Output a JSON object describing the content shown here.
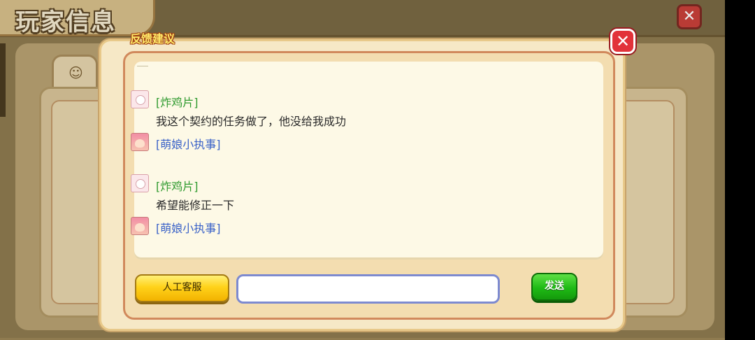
{
  "background": {
    "title": "玩家信息",
    "tab_icon": "face-icon",
    "close_icon": "close-icon"
  },
  "popup": {
    "title": "反馈建议",
    "close_icon": "close-icon"
  },
  "chat": {
    "messages": [
      {
        "sender": "[炸鸡片]",
        "role": "user",
        "text": "我这个契约的任务做了，他没给我成功"
      },
      {
        "sender": "[萌娘小执事]",
        "role": "bot",
        "text": ""
      },
      {
        "sender": "[炸鸡片]",
        "role": "user",
        "text": "希望能修正一下"
      },
      {
        "sender": "[萌娘小执事]",
        "role": "bot",
        "text": ""
      }
    ]
  },
  "controls": {
    "service_label": "人工客服",
    "input_value": "",
    "input_placeholder": "",
    "send_label": "发送"
  },
  "colors": {
    "user_name": "#2e9a2e",
    "bot_name": "#3a62c8",
    "send_button": "#1fba15",
    "service_button": "#ffd21a",
    "close_button": "#e2323a"
  }
}
